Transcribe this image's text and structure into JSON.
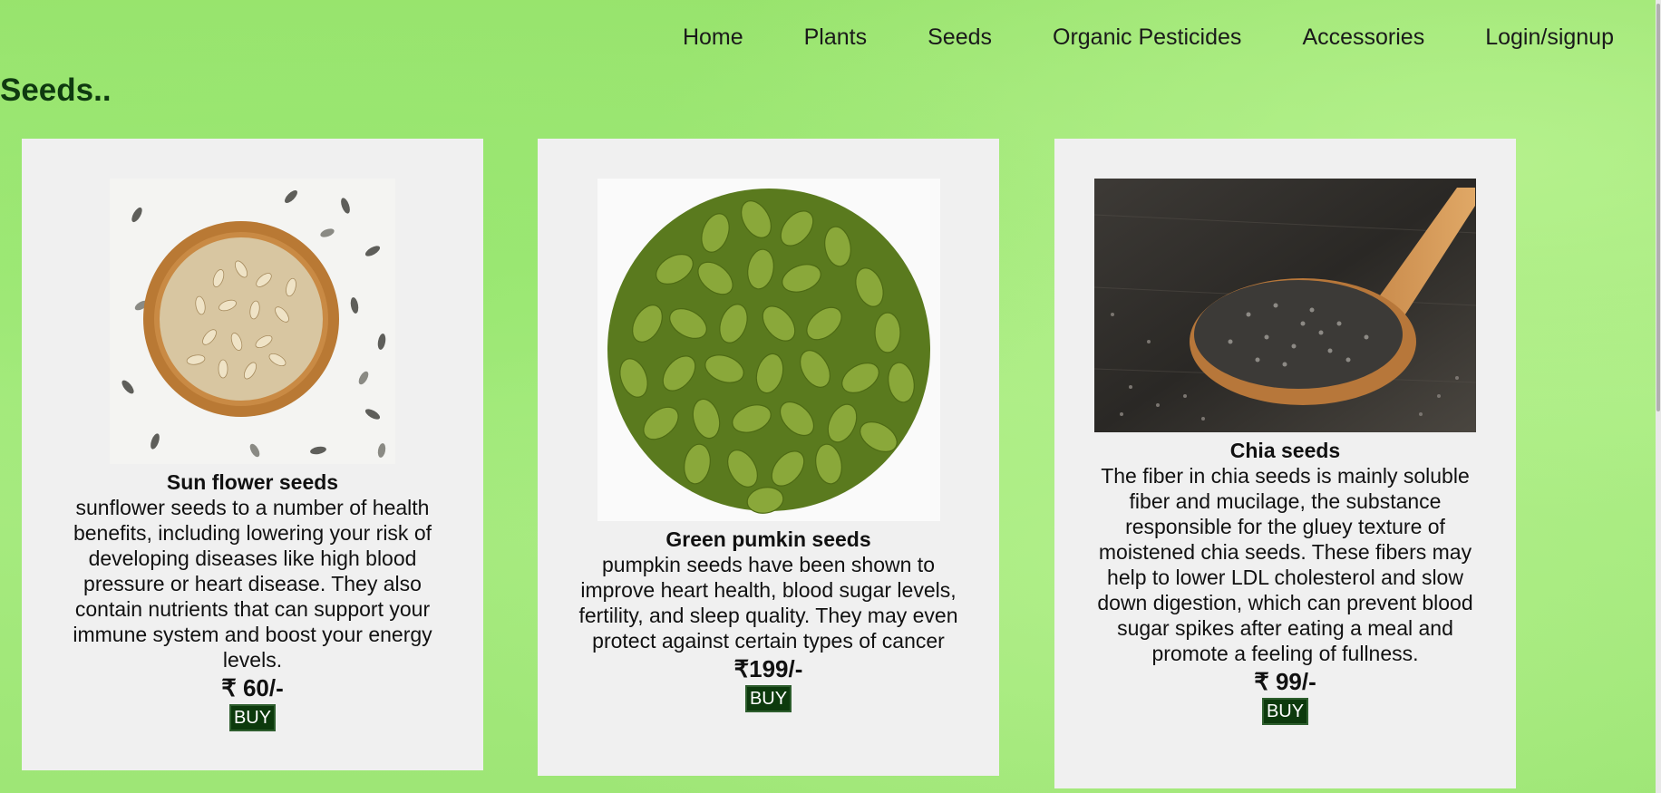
{
  "nav": {
    "items": [
      "Home",
      "Plants",
      "Seeds",
      "Organic Pesticides",
      "Accessories",
      "Login/signup"
    ]
  },
  "page": {
    "title": "Seeds.."
  },
  "products": [
    {
      "name": "Sun flower seeds",
      "description": "sunflower seeds to a number of health benefits, including lowering your risk of developing diseases like high blood pressure or heart disease. They also contain nutrients that can support your immune system and boost your energy levels.",
      "price": "₹ 60/-",
      "buy_label": "BUY",
      "image_icon": "sunflower-seeds-image"
    },
    {
      "name": "Green pumkin seeds",
      "description": "pumpkin seeds have been shown to improve heart health, blood sugar levels, fertility, and sleep quality. They may even protect against certain types of cancer",
      "price": "₹199/-",
      "buy_label": "BUY",
      "image_icon": "pumpkin-seeds-image"
    },
    {
      "name": "Chia seeds",
      "description": "The fiber in chia seeds is mainly soluble fiber and mucilage, the substance responsible for the gluey texture of moistened chia seeds. These fibers may help to lower LDL cholesterol and slow down digestion, which can prevent blood sugar spikes after eating a meal and promote a feeling of fullness.",
      "price": "₹ 99/-",
      "buy_label": "BUY",
      "image_icon": "chia-seeds-image"
    }
  ],
  "colors": {
    "background": "#9fe673",
    "card": "#f0f0f0",
    "buy_button": "#0d3a0d",
    "title": "#0f3a10"
  }
}
